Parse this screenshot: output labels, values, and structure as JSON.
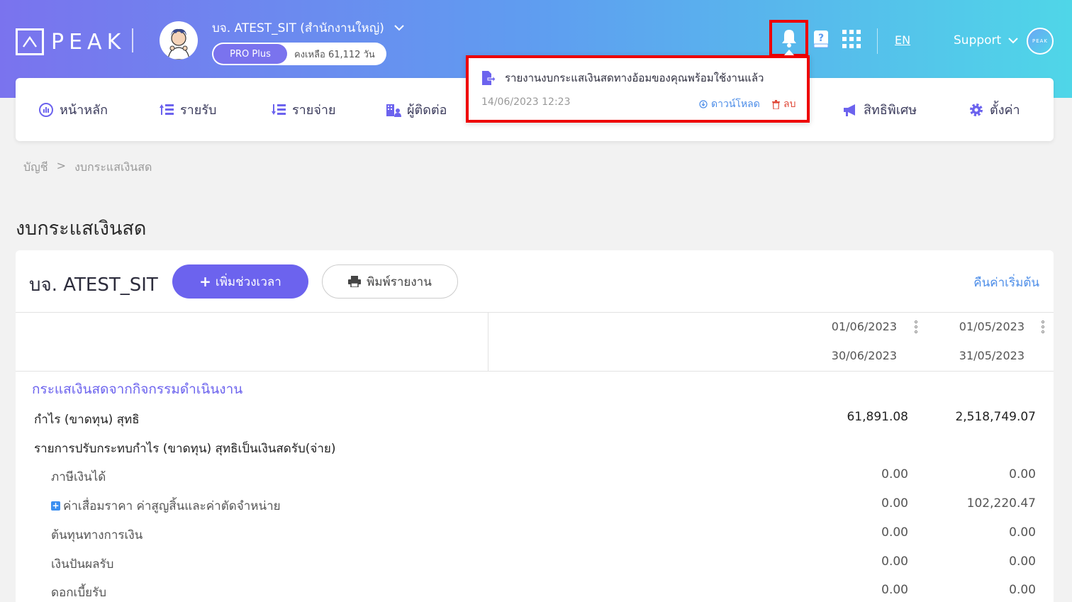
{
  "header": {
    "logo_text": "PEAK",
    "company_name": "บจ. ATEST_SIT (สำนักงานใหญ่)",
    "plan_badge": "PRO Plus",
    "plan_days": "คงเหลือ 61,112 วัน",
    "language": "EN",
    "support": "Support",
    "mini_logo": "PEAK"
  },
  "nav": {
    "items": [
      {
        "label": "หน้าหลัก",
        "icon": "dashboard-icon"
      },
      {
        "label": "รายรับ",
        "icon": "income-icon"
      },
      {
        "label": "รายจ่าย",
        "icon": "expense-icon"
      },
      {
        "label": "ผู้ติดต่อ",
        "icon": "contacts-icon"
      },
      {
        "label": "สิทธิพิเศษ",
        "icon": "megaphone-icon"
      },
      {
        "label": "ตั้งค่า",
        "icon": "gear-icon"
      }
    ]
  },
  "notification": {
    "title": "รายงานงบกระแสเงินสดทางอ้อมของคุณพร้อมใช้งานแล้ว",
    "date": "14/06/2023 12:23",
    "download": "ดาวน์โหลด",
    "delete": "ลบ"
  },
  "breadcrumb": {
    "root": "บัญชี",
    "separator": ">",
    "current": "งบกระแสเงินสด"
  },
  "page_title": "งบกระแสเงินสด",
  "report": {
    "company": "บจ. ATEST_SIT",
    "add_period": "เพิ่มช่วงเวลา",
    "print": "พิมพ์รายงาน",
    "reset": "คืนค่าเริ่มต้น",
    "periods": [
      {
        "start": "01/06/2023",
        "end": "30/06/2023"
      },
      {
        "start": "01/05/2023",
        "end": "31/05/2023"
      }
    ],
    "section": "กระแสเงินสดจากกิจกรรมดำเนินงาน",
    "rows": [
      {
        "label": "กำไร (ขาดทุน) สุทธิ",
        "v1": "61,891.08",
        "v2": "2,518,749.07"
      },
      {
        "label": "รายการปรับกระทบกำไร (ขาดทุน) สุทธิเป็นเงินสดรับ(จ่าย)",
        "v1": "",
        "v2": ""
      },
      {
        "label": "ภาษีเงินได้",
        "v1": "0.00",
        "v2": "0.00"
      },
      {
        "label": "ค่าเสื่อมราคา ค่าสูญสิ้นและค่าตัดจำหน่าย",
        "v1": "0.00",
        "v2": "102,220.47"
      },
      {
        "label": "ต้นทุนทางการเงิน",
        "v1": "0.00",
        "v2": "0.00"
      },
      {
        "label": "เงินปันผลรับ",
        "v1": "0.00",
        "v2": "0.00"
      },
      {
        "label": "ดอกเบี้ยรับ",
        "v1": "0.00",
        "v2": "0.00"
      }
    ]
  }
}
